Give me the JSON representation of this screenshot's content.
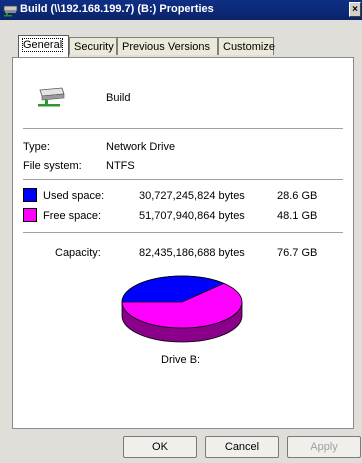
{
  "window": {
    "title": "Build (\\\\192.168.199.7) (B:) Properties",
    "close_label": "×"
  },
  "tabs": [
    {
      "label": "General"
    },
    {
      "label": "Security"
    },
    {
      "label": "Previous Versions"
    },
    {
      "label": "Customize"
    }
  ],
  "drive": {
    "name": "Build",
    "type_label": "Type:",
    "type_value": "Network Drive",
    "fs_label": "File system:",
    "fs_value": "NTFS"
  },
  "space": {
    "used_label": "Used space:",
    "used_bytes": "30,727,245,824 bytes",
    "used_gb": "28.6 GB",
    "free_label": "Free space:",
    "free_bytes": "51,707,940,864 bytes",
    "free_gb": "48.1 GB",
    "capacity_label": "Capacity:",
    "capacity_bytes": "82,435,186,688 bytes",
    "capacity_gb": "76.7 GB",
    "used_color": "#0000ff",
    "free_color": "#ff00ff",
    "used_fraction": 0.3727
  },
  "drive_caption": "Drive B:",
  "buttons": {
    "ok": "OK",
    "cancel": "Cancel",
    "apply": "Apply"
  }
}
